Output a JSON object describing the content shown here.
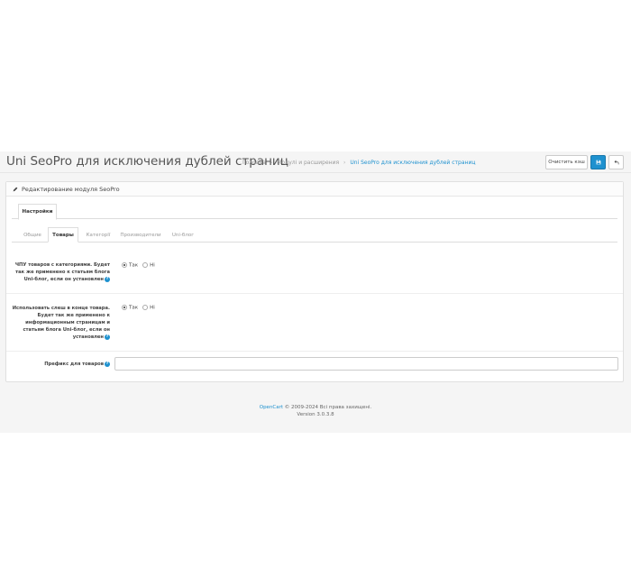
{
  "header": {
    "title": "Uni SeoPro для исключения дублей страниц",
    "breadcrumbs": [
      "Головна",
      "Модулі и расширения",
      "Uni SeoPro для исключения дублей страниц"
    ],
    "clear_cache_label": "Очистить кэш"
  },
  "panel": {
    "heading": "Редактирование модуля SeoPro",
    "main_tab": "Настройки",
    "sub_tabs": [
      "Общие",
      "Товары",
      "Категорії",
      "Производители",
      "Uni-блог"
    ]
  },
  "form": {
    "row1_label": "ЧПУ товаров с категориями. Будет так же применено к статьям блога Uni-блог, если он установлен",
    "row2_label": "Использовать слеш в конце товара. Будет так же применено к информационным страницам и статьям блога Uni-блог, если он установлен",
    "row3_label": "Префикс для товаров",
    "radio_yes": "Так",
    "radio_no": "Ні",
    "prefix_value": ""
  },
  "footer": {
    "brand": "OpenCart",
    "copyright": " © 2009-2024 Всі права захищені.",
    "version": "Version 3.0.3.8"
  },
  "colors": {
    "accent": "#1e91cf",
    "background": "#f5f5f5"
  }
}
